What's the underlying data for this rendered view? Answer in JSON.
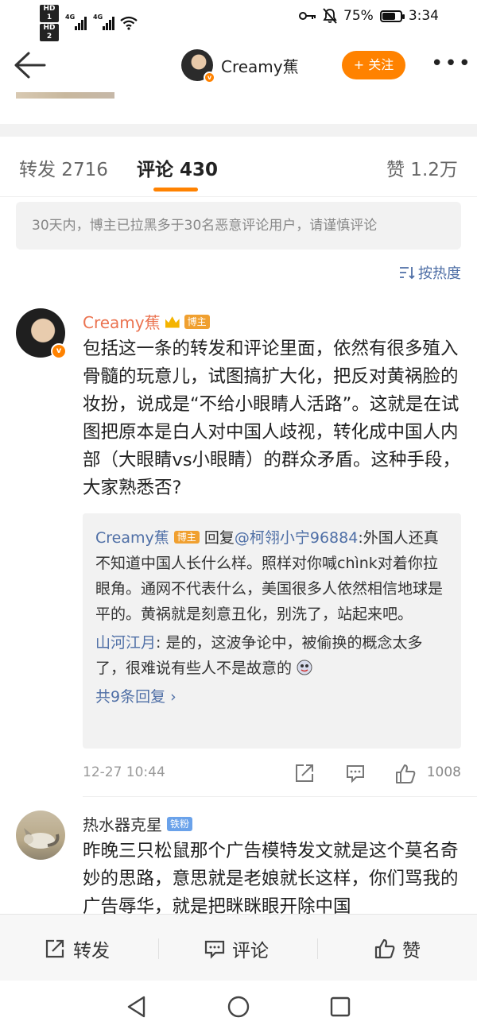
{
  "status_bar": {
    "hd1": "HD 1",
    "hd2": "HD 2",
    "net1": "4G",
    "net2": "4G",
    "battery_pct": "75%",
    "battery_level": 0.75,
    "time": "3:34"
  },
  "header": {
    "user_name": "Creamy蕉",
    "follow_label": "+ 关注",
    "more_label": "•••",
    "verified_mark": "v"
  },
  "tabs": {
    "repost": "转发 2716",
    "comment": "评论 430",
    "like": "赞 1.2万"
  },
  "notice": "30天内，博主已拉黑多于30名恶意评论用户，请谨慎评论",
  "sort_label": "按热度",
  "comments": [
    {
      "user": "Creamy蕉",
      "badge": "博主",
      "text": "包括这一条的转发和评论里面，依然有很多殖入骨髓的玩意儿，试图搞扩大化，把反对黄祸脸的妆扮，说成是“不给小眼睛人活路”。这就是在试图把原本是白人对中国人歧视，转化成中国人内部（大眼睛vs小眼睛）的群众矛盾。这种手段，大家熟悉否?",
      "replies": {
        "r1_user": "Creamy蕉",
        "r1_badge": "博主",
        "r1_prefix": "回复",
        "r1_mention": "@柯翎小宁96884",
        "r1_text": ":外国人还真不知道中国人长什么样。照样对你喊chìnk对着你拉眼角。通网不代表什么，美国很多人依然相信地球是平的。黄祸就是刻意丑化，别洗了，站起来吧。",
        "r2_user": "山河江月",
        "r2_text": ": 是的，这波争论中，被偷换的概念太多了，很难说有些人不是故意的",
        "more_label": "共9条回复 ›"
      },
      "time": "12-27 10:44",
      "likes": "1008"
    },
    {
      "user": "热水器克星",
      "badge": "铁粉",
      "text": "昨晚三只松鼠那个广告模特发文就是这个莫名奇妙的思路，意思就是老娘就长这样，你们骂我的广告辱华，就是把眯眯眼开除中国"
    }
  ],
  "actions": {
    "repost": "转发",
    "comment": "评论",
    "like": "赞"
  },
  "colors": {
    "accent": "#ff8200",
    "link": "#4f6fa6",
    "owner_name": "#eb7350"
  }
}
